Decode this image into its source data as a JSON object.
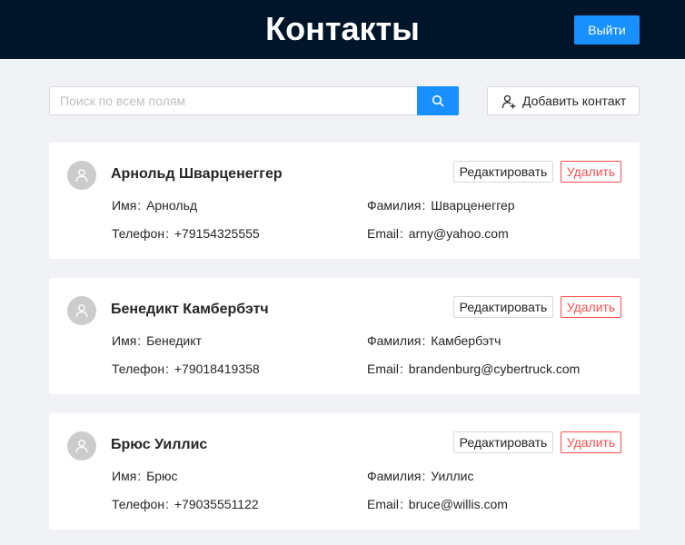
{
  "header": {
    "title": "Контакты",
    "logout_label": "Выйти"
  },
  "toolbar": {
    "search_placeholder": "Поиск по всем полям",
    "search_icon": "search-icon",
    "add_contact_label": "Добавить контакт",
    "add_contact_icon": "user-add-icon"
  },
  "labels": {
    "first_name": "Имя",
    "last_name": "Фамилия",
    "phone": "Телефон",
    "email": "Email",
    "separator": ":",
    "edit": "Редактировать",
    "delete": "Удалить"
  },
  "contacts": [
    {
      "full_name": "Арнольд Шварценеггер",
      "first_name": "Арнольд",
      "last_name": "Шварценеггер",
      "phone": "+79154325555",
      "email": "arny@yahoo.com"
    },
    {
      "full_name": "Бенедикт Камбербэтч",
      "first_name": "Бенедикт",
      "last_name": "Камбербэтч",
      "phone": "+79018419358",
      "email": "brandenburg@cybertruck.com"
    },
    {
      "full_name": "Брюс Уиллис",
      "first_name": "Брюс",
      "last_name": "Уиллис",
      "phone": "+79035551122",
      "email": "bruce@willis.com"
    }
  ],
  "colors": {
    "header_bg": "#001529",
    "primary": "#1890ff",
    "danger": "#ff4d4f",
    "page_bg": "#f0f2f5",
    "avatar_bg": "#cccccc"
  }
}
